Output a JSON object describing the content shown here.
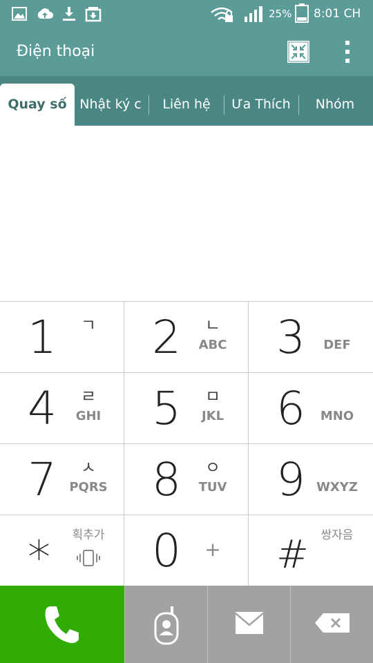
{
  "status_bar": {
    "battery": "25%",
    "time": "8:01 CH",
    "icons": [
      "image-icon",
      "cloud-upload-icon",
      "download-icon",
      "package-icon",
      "wifi-lock-icon",
      "signal-icon",
      "battery-icon"
    ]
  },
  "header": {
    "title": "Điện thoại",
    "icons": [
      "collapse-icon",
      "more-vertical-icon"
    ]
  },
  "tabs": [
    {
      "label": "Quay số",
      "active": true
    },
    {
      "label": "Nhật ký c",
      "active": false
    },
    {
      "label": "Liên hệ",
      "active": false
    },
    {
      "label": "Ưa Thích",
      "active": false
    },
    {
      "label": "Nhóm",
      "active": false
    }
  ],
  "dial_input": {
    "value": ""
  },
  "keypad": {
    "keys": [
      {
        "digit": "1",
        "hangul": "ㄱ",
        "letters": ""
      },
      {
        "digit": "2",
        "hangul": "ㄴ",
        "letters": "ABC"
      },
      {
        "digit": "3",
        "hangul": "",
        "letters": "DEF"
      },
      {
        "digit": "4",
        "hangul": "ㄹ",
        "letters": "GHI"
      },
      {
        "digit": "5",
        "hangul": "ㅁ",
        "letters": "JKL"
      },
      {
        "digit": "6",
        "hangul": "",
        "letters": "MNO"
      },
      {
        "digit": "7",
        "hangul": "ㅅ",
        "letters": "PQRS"
      },
      {
        "digit": "8",
        "hangul": "ㅇ",
        "letters": "TUV"
      },
      {
        "digit": "9",
        "hangul": "",
        "letters": "WXYZ"
      },
      {
        "digit": "*",
        "hangul": "획추가",
        "letters": ""
      },
      {
        "digit": "0",
        "hangul": "+",
        "letters": ""
      },
      {
        "digit": "#",
        "hangul": "쌍자음",
        "letters": ""
      }
    ]
  },
  "actions": {
    "icons": [
      "phone-icon",
      "voicemail-icon",
      "message-icon",
      "backspace-icon"
    ],
    "colors": {
      "call": "#30ac05",
      "secondary": "#a2a2a2",
      "header": "#5b9c98",
      "tabs": "#4a8784"
    }
  }
}
